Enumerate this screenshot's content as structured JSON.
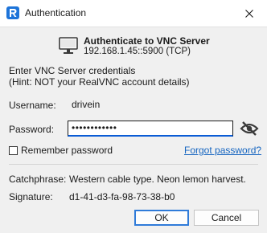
{
  "window": {
    "title": "Authentication",
    "icon": "realvnc-logo-icon",
    "close_icon": "close-icon"
  },
  "server": {
    "heading": "Authenticate to VNC Server",
    "address": "192.168.1.45::5900 (TCP)",
    "icon": "monitor-icon"
  },
  "instructions": {
    "line1": "Enter VNC Server credentials",
    "line2": "(Hint: NOT your RealVNC account details)"
  },
  "form": {
    "username_label": "Username:",
    "username_value": "drivein",
    "password_label": "Password:",
    "password_value": "••••••••••••",
    "show_password_icon": "eye-slash-icon",
    "remember_label": "Remember password",
    "remember_checked": false,
    "forgot_link": "Forgot password?"
  },
  "info": {
    "catchphrase_label": "Catchphrase:",
    "catchphrase_value": "Western cable type. Neon lemon harvest.",
    "signature_label": "Signature:",
    "signature_value": "d1-41-d3-fa-98-73-38-b0"
  },
  "buttons": {
    "ok": "OK",
    "cancel": "Cancel"
  },
  "colors": {
    "accent": "#0b5cd5",
    "link": "#1565c0",
    "logo": "#1d74d9"
  }
}
